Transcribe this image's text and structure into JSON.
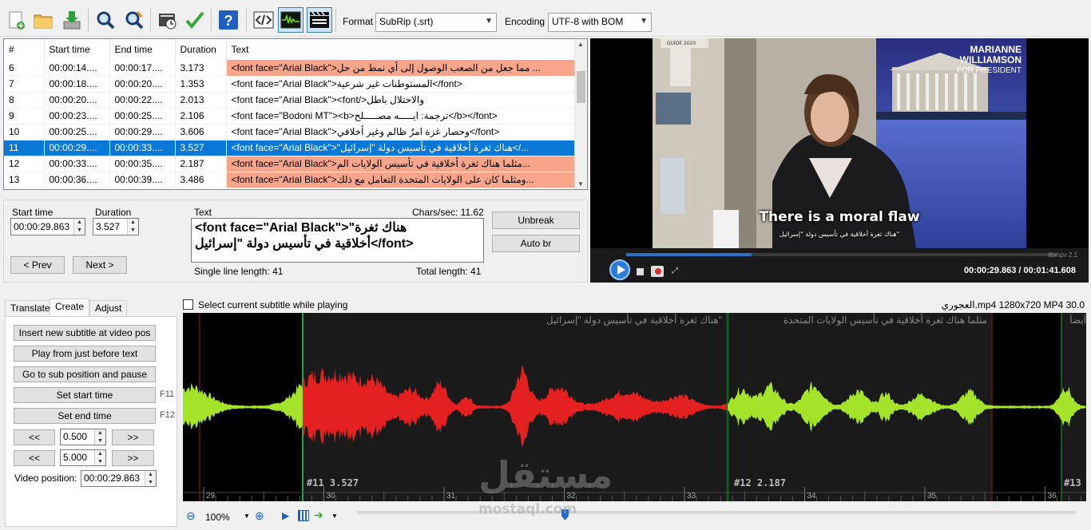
{
  "toolbar": {
    "format_label": "Format",
    "format_value": "SubRip (.srt)",
    "encoding_label": "Encoding",
    "encoding_value": "UTF-8 with BOM"
  },
  "grid": {
    "columns": [
      "#",
      "Start time",
      "End time",
      "Duration",
      "Text"
    ],
    "rows": [
      {
        "num": "6",
        "start": "00:00:14....",
        "end": "00:00:17....",
        "dur": "3.173",
        "text": "<font face=\"Arial Black\">مما جعل من الصعب الوصول إلى أي نمط من حل ..."
      },
      {
        "num": "7",
        "start": "00:00:18....",
        "end": "00:00:20....",
        "dur": "1.353",
        "text": "<font face=\"Arial Black\">المستوطنات غير شرعية</font>"
      },
      {
        "num": "8",
        "start": "00:00:20....",
        "end": "00:00:22....",
        "dur": "2.013",
        "text": "<font face=\"Arial Black\"><font/>والاحتلال باطل"
      },
      {
        "num": "9",
        "start": "00:00:23....",
        "end": "00:00:25....",
        "dur": "2.106",
        "text": "<font face=\"Bodoni MT\"><b>ترجمة: ايـــــه مصـــــلح</b></font>"
      },
      {
        "num": "10",
        "start": "00:00:25....",
        "end": "00:00:29....",
        "dur": "3.606",
        "text": "<font face=\"Arial Black\">وحصار غزة امرٌ ظالم وغير أخلاقي</font>"
      },
      {
        "num": "11",
        "start": "00:00:29....",
        "end": "00:00:33....",
        "dur": "3.527",
        "text": "<font face=\"Arial Black\">\"هناك ثغرة أخلاقية في تأسيس دولة \"إسرائيل</..."
      },
      {
        "num": "12",
        "start": "00:00:33....",
        "end": "00:00:35....",
        "dur": "2.187",
        "text": "<font face=\"Arial Black\">مثلما هناك ثغرة أخلاقية في تأسيس الولايات الم..."
      },
      {
        "num": "13",
        "start": "00:00:36....",
        "end": "00:00:39....",
        "dur": "3.486",
        "text": "<font face=\"Arial Black\">ومثلما كان على الولايات المتحدة التعامل مع ذلك..."
      }
    ]
  },
  "edit": {
    "start_label": "Start time",
    "start_value": "00:00:29.863",
    "duration_label": "Duration",
    "duration_value": "3.527",
    "text_label": "Text",
    "chars_sec": "Chars/sec: 11.62",
    "text_line1": "<font face=\"Arial Black\">\"هناك ثغرة",
    "text_line2": "أخلاقية في تأسيس دولة \"إسرائيل</font>",
    "prev": "< Prev",
    "next": "Next >",
    "unbreak": "Unbreak",
    "autobr": "Auto br",
    "single_line": "Single line length: 41",
    "total_length": "Total length: 41"
  },
  "video": {
    "caption_en": "There is a moral flaw",
    "caption_ar": "هناك ثغرة أخلاقية في تأسيس دولة \"إسرائيل\"",
    "logo_line1": "MARIANNE",
    "logo_line2": "WILLIAMSON",
    "logo_line3": "FOR PRESIDENT",
    "book_title": "GUIDE 2020",
    "player_brand": "libmpv 2.1",
    "time": "00:00:29.863 / 00:01:41.608"
  },
  "tabs": [
    "Translate",
    "Create",
    "Adjust"
  ],
  "create": {
    "insert": "Insert new subtitle at video pos",
    "play_before": "Play from just before text",
    "goto_pause": "Go to sub position and pause",
    "set_start": "Set start time",
    "set_start_key": "F11",
    "set_end": "Set end time",
    "set_end_key": "F12",
    "back": "<<",
    "fwd": ">>",
    "step1": "0.500",
    "step2": "5.000",
    "video_pos_label": "Video position:",
    "video_pos": "00:00:29.863"
  },
  "waveform": {
    "checkbox_label": "Select current subtitle while playing",
    "media_info": "العجوري.mp4 1280x720 MP4 30.0",
    "sub11_text": "هناك ثغرة أخلاقية في تأسيس دولة \"إسرائيل\"",
    "sub11_label": "#11  3.527",
    "sub12_text": "مثلما هناك ثغرة أخلاقية في تأسيس الولايات المتحدة",
    "sub12_label": "#12  2.187",
    "sub13_text": "أيضاً",
    "sub13_label": "#13",
    "ticks": [
      "29",
      "30",
      "31",
      "32",
      "33",
      "34",
      "35",
      "36"
    ],
    "zoom": "100%",
    "watermark": "مستقل",
    "watermark_sub": "mostaql.com"
  }
}
